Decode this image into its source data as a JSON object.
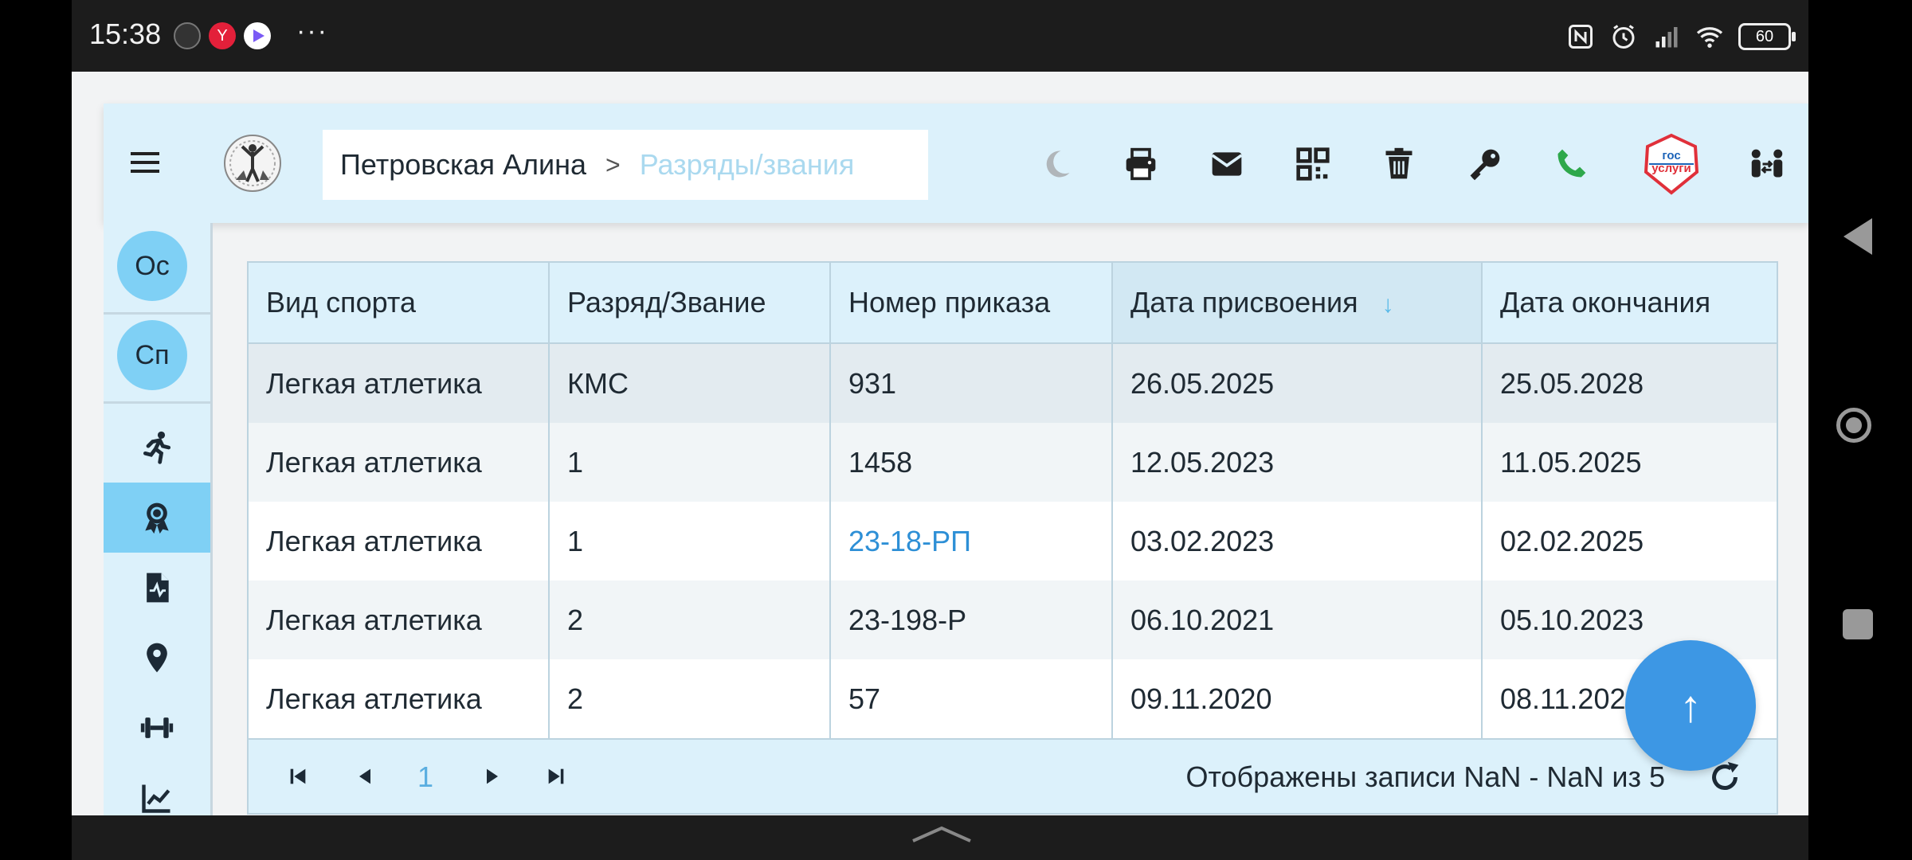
{
  "status_bar": {
    "time": "15:38",
    "battery": "60",
    "icons": [
      "clock-app-icon",
      "yandex-app-icon",
      "play-app-icon",
      "more-dots-icon",
      "nfc-icon",
      "alarm-icon",
      "signal-icon",
      "wifi-icon",
      "battery-icon"
    ]
  },
  "header": {
    "breadcrumb_name": "Петровская Алина",
    "breadcrumb_separator": ">",
    "breadcrumb_current": "Разряды/звания",
    "gosuslugi_line1": "гос",
    "gosuslugi_line2": "услуги",
    "tools": [
      "moon-icon",
      "printer-icon",
      "envelope-icon",
      "qr-code-icon",
      "trash-icon",
      "key-icon",
      "phone-icon",
      "gosuslugi-icon",
      "people-exchange-icon"
    ]
  },
  "sidebar": {
    "avatar1": "Ос",
    "avatar2": "Сп",
    "icons": [
      "running-icon",
      "award-icon",
      "medical-file-icon",
      "location-pin-icon",
      "dumbbell-icon",
      "chart-icon"
    ]
  },
  "table": {
    "columns": [
      "Вид спорта",
      "Разряд/Звание",
      "Номер приказа",
      "Дата присвоения",
      "Дата окончания"
    ],
    "sort_arrow": "↓",
    "rows": [
      [
        "Легкая атлетика",
        "КМС",
        "931",
        "26.05.2025",
        "25.05.2028"
      ],
      [
        "Легкая атлетика",
        "1",
        "1458",
        "12.05.2023",
        "11.05.2025"
      ],
      [
        "Легкая атлетика",
        "1",
        "23-18-РП",
        "03.02.2023",
        "02.02.2025"
      ],
      [
        "Легкая атлетика",
        "2",
        "23-198-Р",
        "06.10.2021",
        "05.10.2023"
      ],
      [
        "Легкая атлетика",
        "2",
        "57",
        "09.11.2020",
        "08.11.2022"
      ]
    ]
  },
  "pager": {
    "page": "1",
    "info": "Отображены записи NaN - NaN из 5"
  },
  "fab": {
    "label": "↑"
  },
  "colors": {
    "header_bg": "#dcf1fb",
    "accent": "#7fd0f5",
    "link": "#2d8fd6",
    "fab": "#3d97e4",
    "phone": "#2ea84b"
  }
}
